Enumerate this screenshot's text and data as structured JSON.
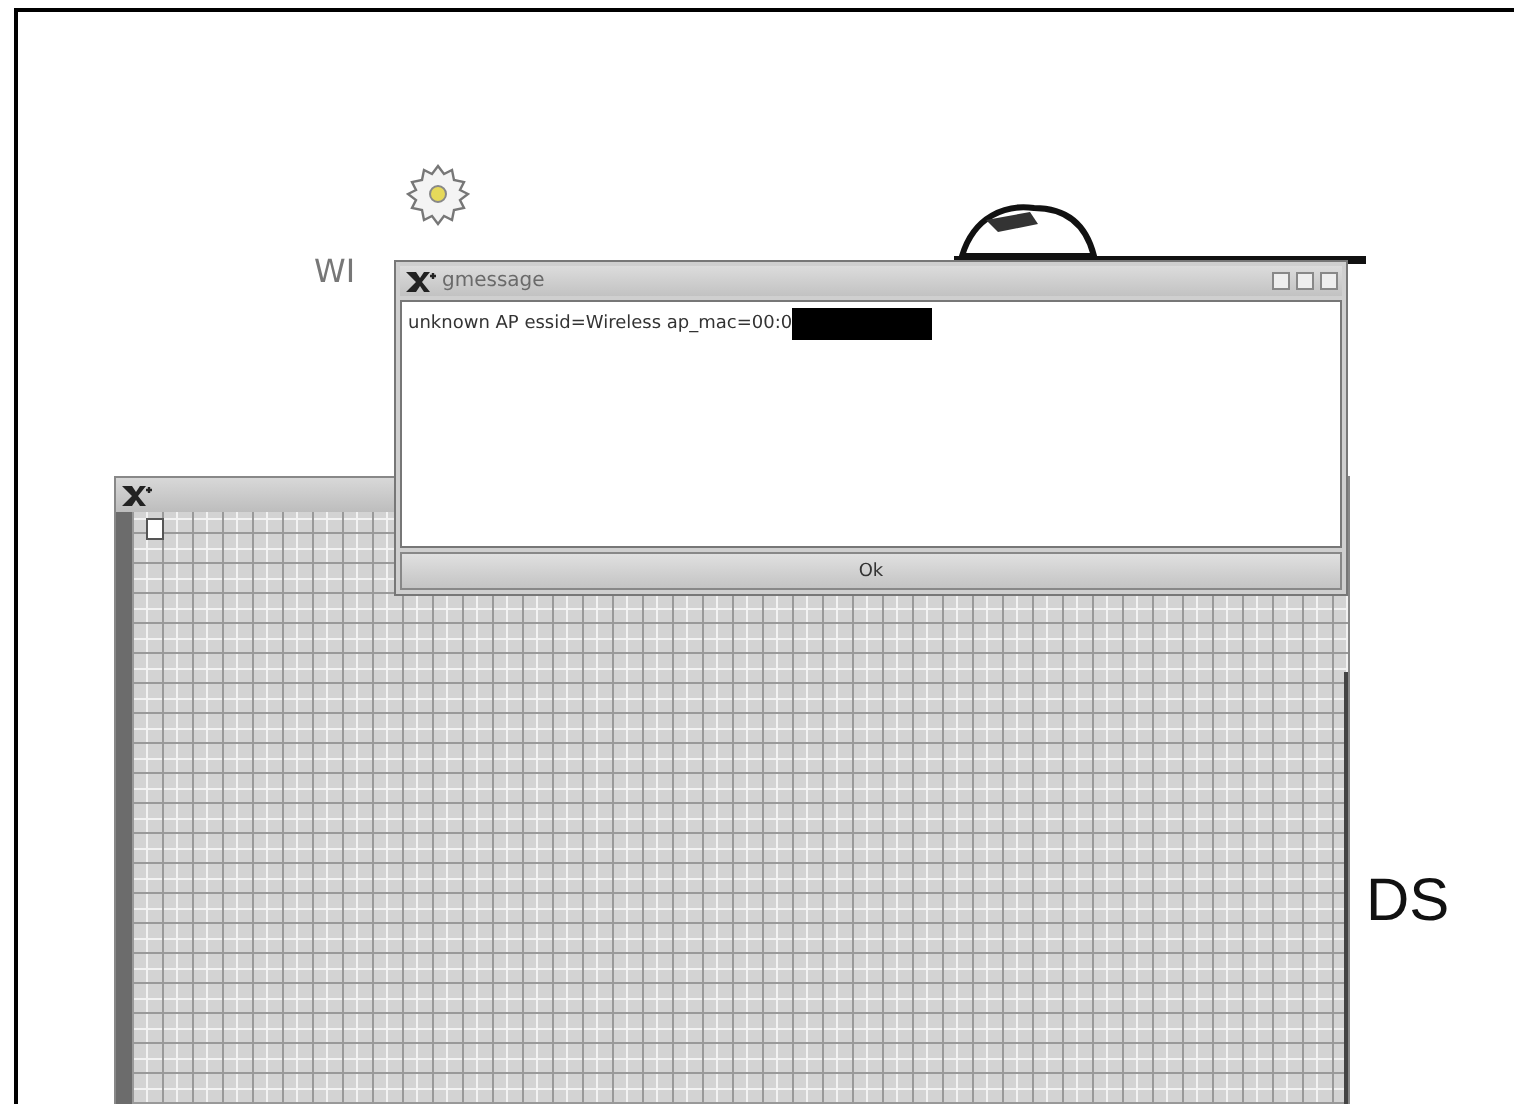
{
  "desktop": {
    "icon_label": "WI",
    "side_label": "DS"
  },
  "dialog": {
    "title": "gmessage",
    "message": "unknown AP essid=Wireless ap_mac=00:0",
    "redacted": true,
    "buttons": [
      "Ok"
    ]
  }
}
